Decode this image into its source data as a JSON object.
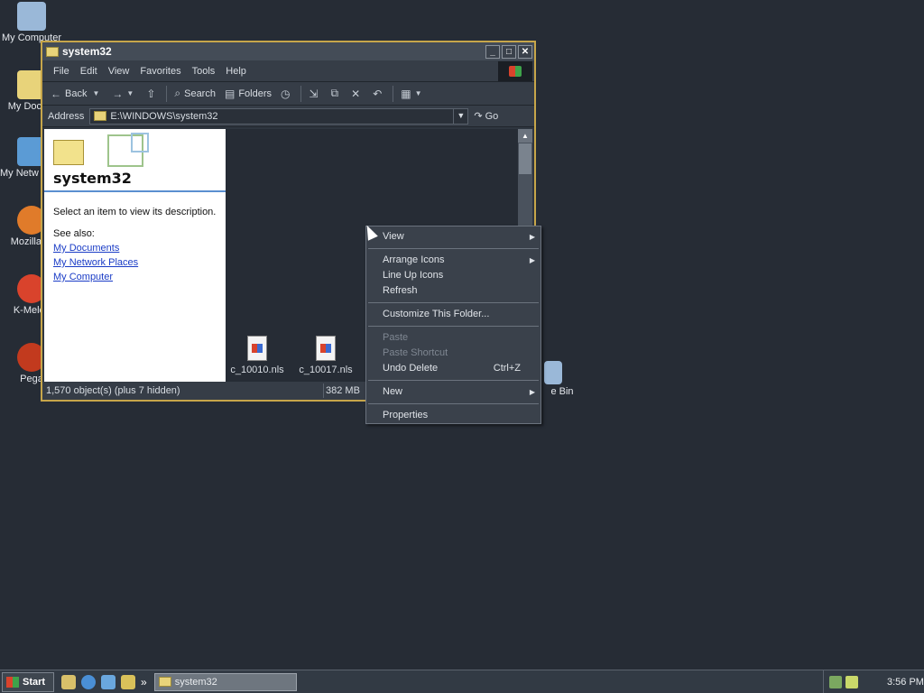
{
  "desktop": {
    "icons": [
      {
        "label": "My Computer",
        "icon": "my-computer-icon",
        "color": "#9ab8d8"
      },
      {
        "label": "My Docum",
        "icon": "my-documents-icon",
        "color": "#e8d37a"
      },
      {
        "label": "My Netw Place",
        "icon": "network-places-icon",
        "color": "#5b9bd5"
      },
      {
        "label": "Mozilla Fi",
        "icon": "firefox-icon",
        "color": "#e07b2a"
      },
      {
        "label": "K-Melec",
        "icon": "k-meleon-icon",
        "color": "#d9432c"
      },
      {
        "label": "Pega",
        "icon": "pegasus-icon",
        "color": "#c23a1e"
      },
      {
        "label": "e Bin",
        "icon": "recycle-bin-icon",
        "color": "#9ab8d8"
      }
    ]
  },
  "window": {
    "title": "system32",
    "buttons": {
      "minimize": "_",
      "maximize": "□",
      "close": "✕"
    },
    "menu": [
      "File",
      "Edit",
      "View",
      "Favorites",
      "Tools",
      "Help"
    ],
    "toolbar": {
      "back": "Back",
      "search": "Search",
      "folders": "Folders"
    },
    "address": {
      "label": "Address",
      "value": "E:\\WINDOWS\\system32",
      "go": "Go"
    },
    "left_pane": {
      "title": "system32",
      "description": "Select an item to view its description.",
      "see_also": "See also:",
      "links": [
        "My Documents",
        "My Network Places",
        "My Computer"
      ]
    },
    "files": [
      {
        "name": "c_10010.nls"
      },
      {
        "name": "c_10017.nls"
      }
    ],
    "status": {
      "objects": "1,570 object(s) (plus 7 hidden)",
      "size": "382 MB"
    }
  },
  "context_menu": {
    "items": [
      {
        "label": "View",
        "submenu": true
      },
      {
        "label": "Arrange Icons",
        "submenu": true
      },
      {
        "label": "Line Up Icons"
      },
      {
        "label": "Refresh"
      },
      {
        "label": "Customize This Folder..."
      },
      {
        "label": "Paste",
        "disabled": true
      },
      {
        "label": "Paste Shortcut",
        "disabled": true
      },
      {
        "label": "Undo Delete",
        "shortcut": "Ctrl+Z"
      },
      {
        "label": "New",
        "submenu": true
      },
      {
        "label": "Properties"
      }
    ]
  },
  "taskbar": {
    "start": "Start",
    "task": "system32",
    "more": "»",
    "clock": "3:56 PM"
  }
}
